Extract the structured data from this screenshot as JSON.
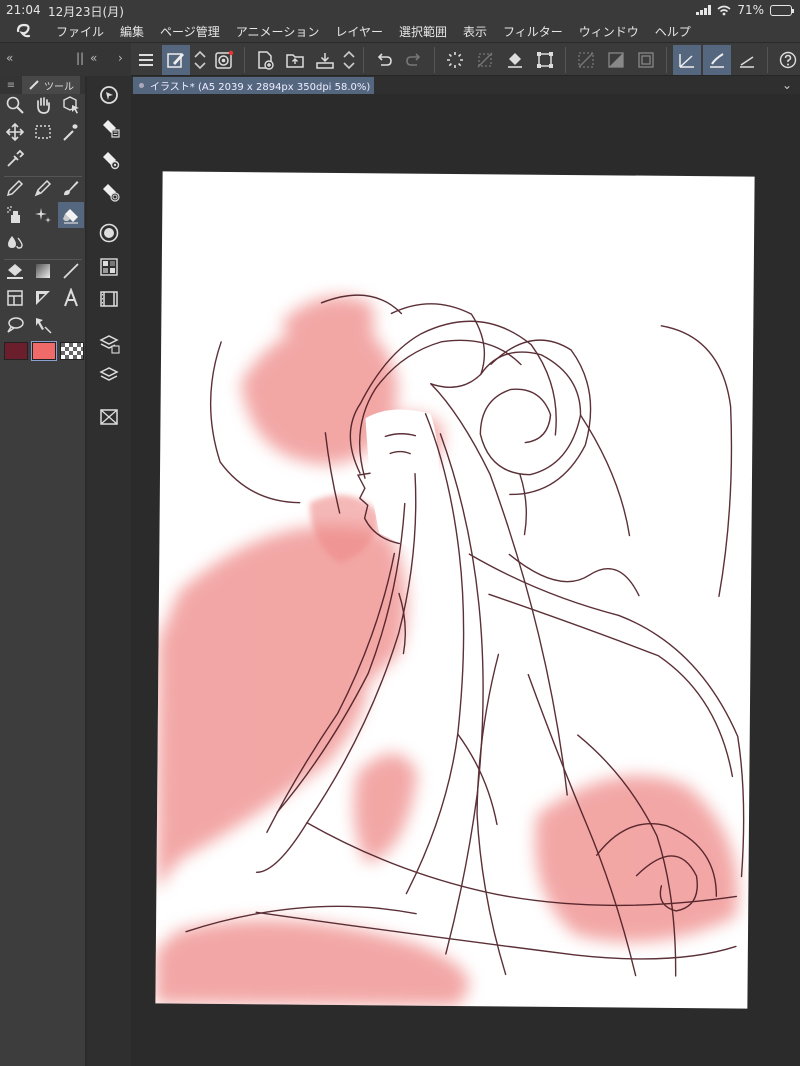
{
  "status": {
    "time": "21:04",
    "date": "12月23日(月)",
    "battery": "71%",
    "battery_level": 0.71
  },
  "menu": {
    "items": [
      "ファイル",
      "編集",
      "ページ管理",
      "アニメーション",
      "レイヤー",
      "選択範囲",
      "表示",
      "フィルター",
      "ウィンドウ",
      "ヘルプ"
    ]
  },
  "toolbar": {
    "collapse_left": "«",
    "splitter": "||",
    "collapse_mid": "«",
    "expand": "›"
  },
  "tool_panel": {
    "tab_label": "ツール",
    "menu_glyph": "≡"
  },
  "document": {
    "tab_title": "イラスト* (A5 2039 x 2894px 350dpi 58.0%)",
    "expand_glyph": "⌄"
  },
  "colors": {
    "main": "#6b1f2c",
    "sub": "#f06a6a",
    "accent_selected": "#55667f",
    "sketch_line": "#4a1a22",
    "wash": "#ee8a88"
  }
}
